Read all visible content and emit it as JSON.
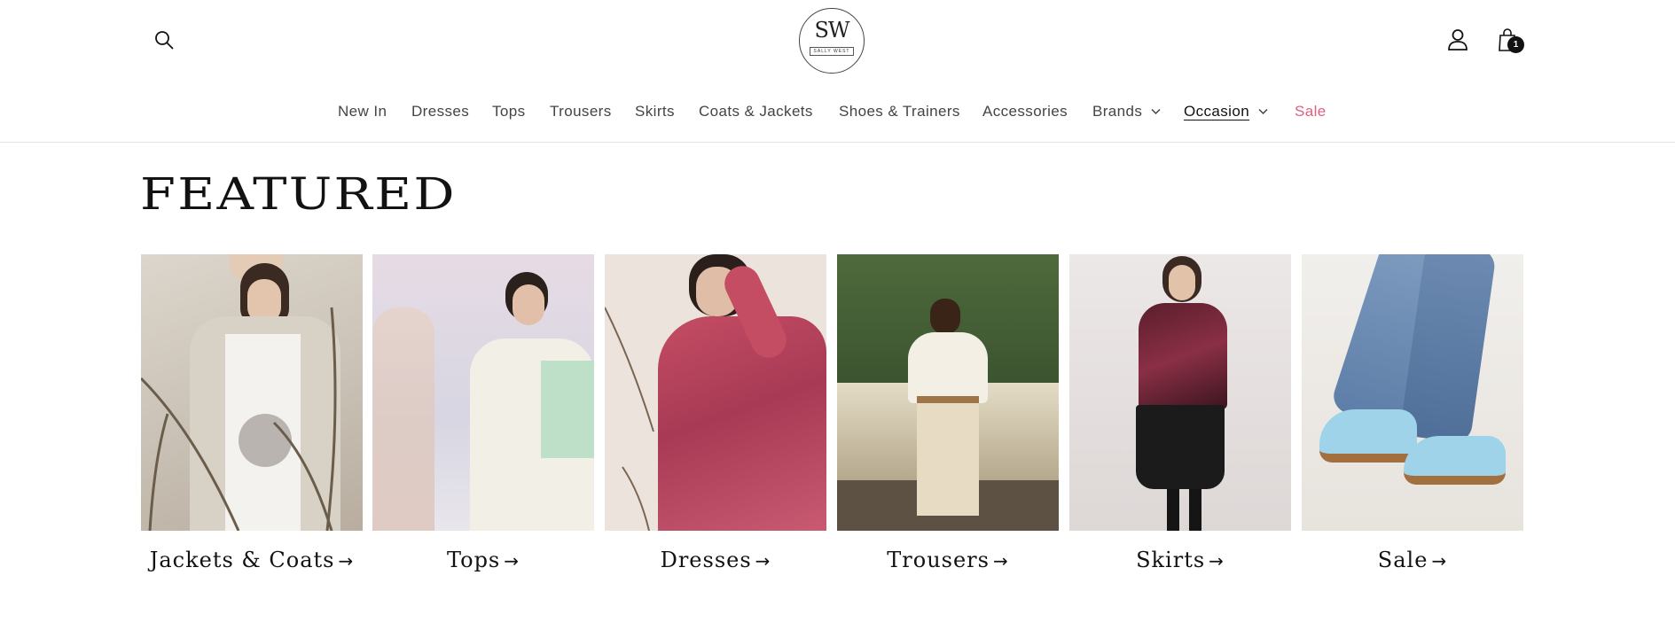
{
  "header": {
    "logo": {
      "mark": "SW",
      "wordmark": "SALLY WEST"
    },
    "icons": {
      "search": "search-icon",
      "account": "account-icon",
      "cart": "bag-icon"
    },
    "cart_count": "1"
  },
  "nav": {
    "items": [
      {
        "label": "New In"
      },
      {
        "label": "Dresses"
      },
      {
        "label": "Tops"
      },
      {
        "label": "Trousers"
      },
      {
        "label": "Skirts"
      },
      {
        "label": "Coats & Jackets"
      },
      {
        "label": "Shoes & Trainers"
      },
      {
        "label": "Accessories"
      },
      {
        "label": "Brands",
        "has_dropdown": true
      },
      {
        "label": "Occasion",
        "has_dropdown": true,
        "active": true
      },
      {
        "label": "Sale",
        "color": "#e0607e"
      }
    ]
  },
  "featured": {
    "title": "FEATURED",
    "cards": [
      {
        "label": "Jackets & Coats",
        "arrow": "→"
      },
      {
        "label": "Tops",
        "arrow": "→"
      },
      {
        "label": "Dresses",
        "arrow": "→"
      },
      {
        "label": "Trousers",
        "arrow": "→"
      },
      {
        "label": "Skirts",
        "arrow": "→"
      },
      {
        "label": "Sale",
        "arrow": "→"
      }
    ]
  },
  "colors": {
    "text": "#121212",
    "sale": "#e0607e",
    "divider": "#e3e3e3"
  }
}
